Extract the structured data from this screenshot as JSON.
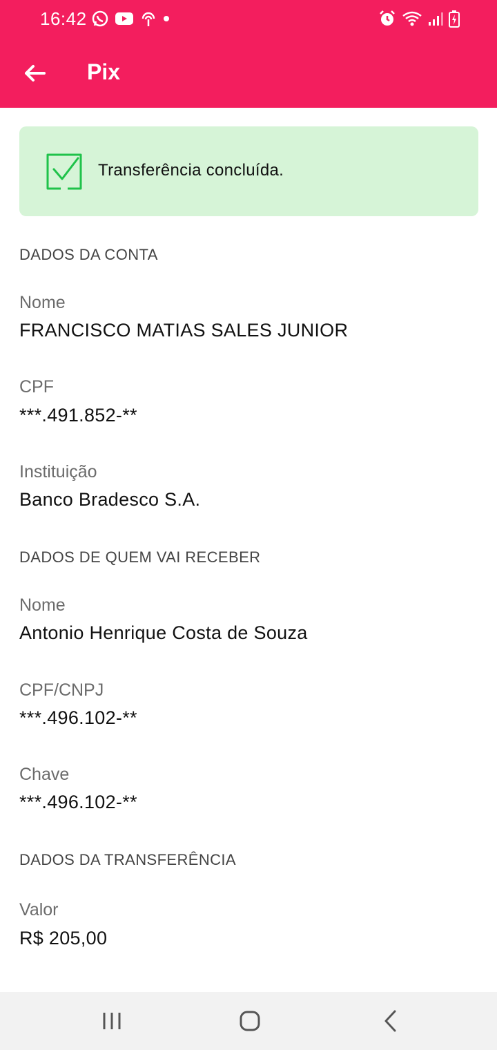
{
  "status_bar": {
    "time": "16:42"
  },
  "app_bar": {
    "title": "Pix"
  },
  "success_banner": {
    "message": "Transferência concluída."
  },
  "account_section": {
    "heading": "DADOS DA CONTA",
    "name_label": "Nome",
    "name_value": "FRANCISCO MATIAS SALES JUNIOR",
    "cpf_label": "CPF",
    "cpf_value": "***.491.852-**",
    "institution_label": "Instituição",
    "institution_value": "Banco Bradesco S.A."
  },
  "recipient_section": {
    "heading": "DADOS DE QUEM VAI RECEBER",
    "name_label": "Nome",
    "name_value": "Antonio Henrique Costa de Souza",
    "doc_label": "CPF/CNPJ",
    "doc_value": "***.496.102-**",
    "key_label": "Chave",
    "key_value": "***.496.102-**"
  },
  "transfer_section": {
    "heading": "DADOS DA TRANSFERÊNCIA",
    "amount_label": "Valor",
    "amount_value": "R$ 205,00"
  },
  "colors": {
    "brand": "#f31e5e",
    "success_bg": "#d6f4d7",
    "success_icon": "#1fc24a"
  }
}
